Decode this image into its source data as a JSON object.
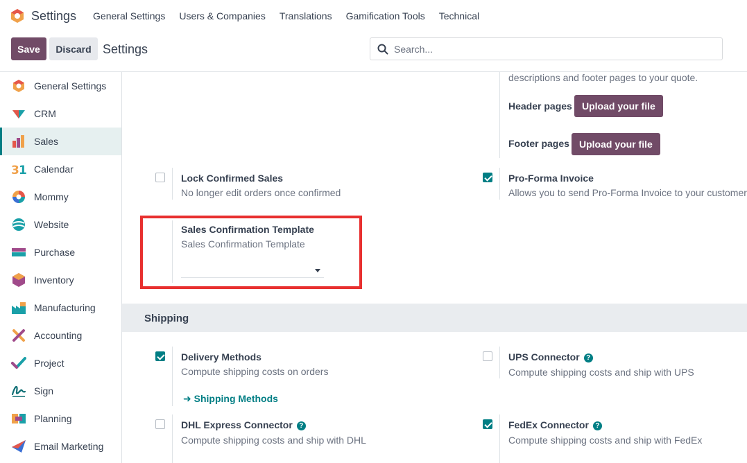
{
  "app": {
    "name": "Settings",
    "nav_items": [
      "General Settings",
      "Users & Companies",
      "Translations",
      "Gamification Tools",
      "Technical"
    ]
  },
  "control": {
    "save_label": "Save",
    "discard_label": "Discard",
    "page_title": "Settings",
    "search_placeholder": "Search..."
  },
  "sidebar": {
    "items": [
      {
        "label": "General Settings",
        "icon": "general-settings-icon"
      },
      {
        "label": "CRM",
        "icon": "crm-icon"
      },
      {
        "label": "Sales",
        "icon": "sales-icon",
        "active": true
      },
      {
        "label": "Calendar",
        "icon": "calendar-icon"
      },
      {
        "label": "Mommy",
        "icon": "mommy-icon"
      },
      {
        "label": "Website",
        "icon": "website-icon"
      },
      {
        "label": "Purchase",
        "icon": "purchase-icon"
      },
      {
        "label": "Inventory",
        "icon": "inventory-icon"
      },
      {
        "label": "Manufacturing",
        "icon": "manufacturing-icon"
      },
      {
        "label": "Accounting",
        "icon": "accounting-icon"
      },
      {
        "label": "Project",
        "icon": "project-icon"
      },
      {
        "label": "Sign",
        "icon": "sign-icon"
      },
      {
        "label": "Planning",
        "icon": "planning-icon"
      },
      {
        "label": "Email Marketing",
        "icon": "email-marketing-icon"
      }
    ]
  },
  "quote": {
    "desc_tail": "descriptions and footer pages to your quote.",
    "header_pages_label": "Header pages",
    "footer_pages_label": "Footer pages",
    "upload_label": "Upload your file"
  },
  "settings": {
    "lock_confirmed": {
      "title": "Lock Confirmed Sales",
      "desc": "No longer edit orders once confirmed",
      "checked": false
    },
    "pro_forma": {
      "title": "Pro-Forma Invoice",
      "desc": "Allows you to send Pro-Forma Invoice to your customers",
      "checked": true
    },
    "confirmation_template": {
      "title": "Sales Confirmation Template",
      "desc": "Sales Confirmation Template",
      "value": ""
    }
  },
  "shipping": {
    "header": "Shipping",
    "delivery_methods": {
      "title": "Delivery Methods",
      "desc": "Compute shipping costs on orders",
      "checked": true,
      "link": "Shipping Methods"
    },
    "ups": {
      "title": "UPS Connector",
      "desc": "Compute shipping costs and ship with UPS",
      "checked": false
    },
    "dhl": {
      "title": "DHL Express Connector",
      "desc": "Compute shipping costs and ship with DHL",
      "checked": false
    },
    "fedex": {
      "title": "FedEx Connector",
      "desc": "Compute shipping costs and ship with FedEx",
      "checked": true
    }
  },
  "colors": {
    "primary": "#714b67",
    "accent": "#017e84",
    "highlight": "#e8302f"
  }
}
